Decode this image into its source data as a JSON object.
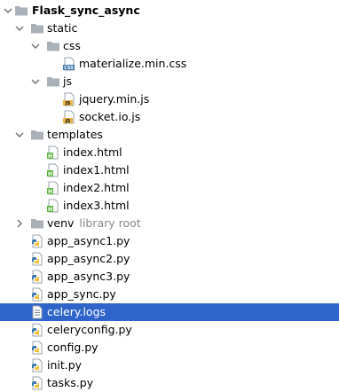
{
  "project_tree": {
    "root": {
      "label": "Flask_sync_async"
    },
    "static": {
      "label": "static"
    },
    "css": {
      "label": "css"
    },
    "materialize": {
      "label": "materialize.min.css",
      "badge": "CSS"
    },
    "js": {
      "label": "js"
    },
    "jquery": {
      "label": "jquery.min.js",
      "badge": "JS"
    },
    "socketio": {
      "label": "socket.io.js",
      "badge": "JS"
    },
    "templates": {
      "label": "templates"
    },
    "index": {
      "label": "index.html",
      "badge": "H"
    },
    "index1": {
      "label": "index1.html",
      "badge": "H"
    },
    "index2": {
      "label": "index2.html",
      "badge": "H"
    },
    "index3": {
      "label": "index3.html",
      "badge": "H"
    },
    "venv": {
      "label": "venv",
      "hint": "library root"
    },
    "app_async1": {
      "label": "app_async1.py"
    },
    "app_async2": {
      "label": "app_async2.py"
    },
    "app_async3": {
      "label": "app_async3.py"
    },
    "app_sync": {
      "label": "app_sync.py"
    },
    "celery_logs": {
      "label": "celery.logs",
      "selected": true
    },
    "celeryconfig": {
      "label": "celeryconfig.py"
    },
    "config": {
      "label": "config.py"
    },
    "init": {
      "label": "init.py"
    },
    "tasks": {
      "label": "tasks.py"
    }
  },
  "colors": {
    "selection": "#2f65ca",
    "folder": "#a9b0b8",
    "hint": "#8a8a8a",
    "html_badge": "#62b543",
    "css_js_badge": "#e8b64a",
    "python_blue": "#3c78aa",
    "python_yellow": "#f0c33c"
  }
}
